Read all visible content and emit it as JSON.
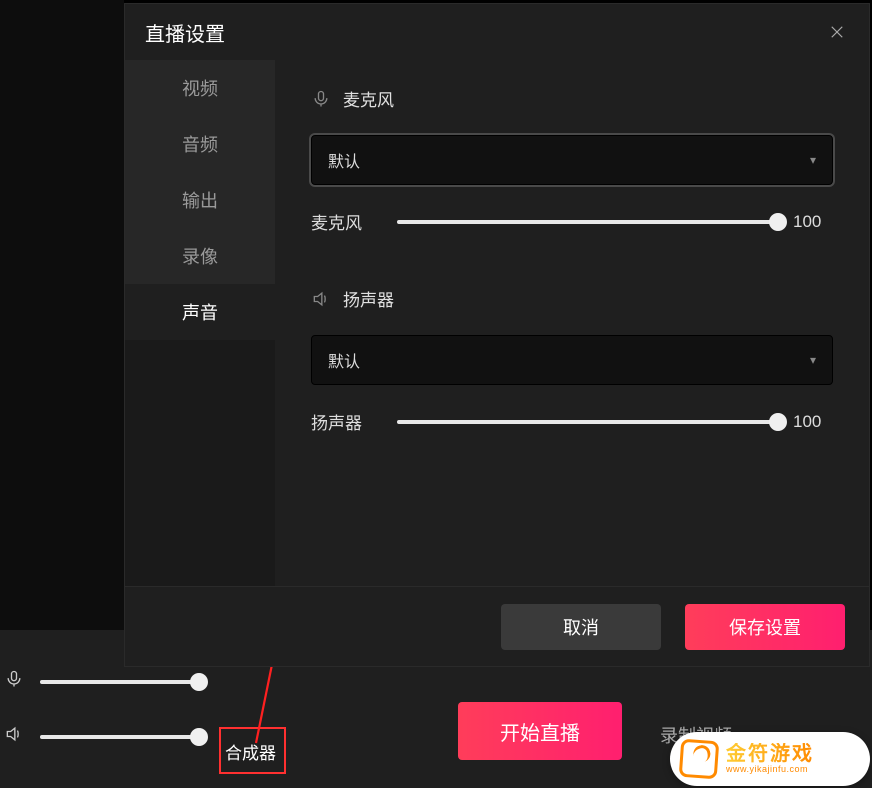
{
  "modal": {
    "title": "直播设置",
    "tabs": [
      {
        "label": "视频"
      },
      {
        "label": "音频"
      },
      {
        "label": "输出"
      },
      {
        "label": "录像"
      },
      {
        "label": "声音"
      }
    ],
    "mic": {
      "section_label": "麦克风",
      "selected": "默认",
      "slider_label": "麦克风",
      "slider_value": "100"
    },
    "speaker": {
      "section_label": "扬声器",
      "selected": "默认",
      "slider_label": "扬声器",
      "slider_value": "100"
    },
    "footer": {
      "cancel": "取消",
      "save": "保存设置"
    }
  },
  "bottom": {
    "mixer_label": "合成器",
    "start_label": "开始直播",
    "record_label": "录制视频"
  },
  "watermark": {
    "cn": "金符游戏",
    "en": "www.yikajinfu.com"
  }
}
